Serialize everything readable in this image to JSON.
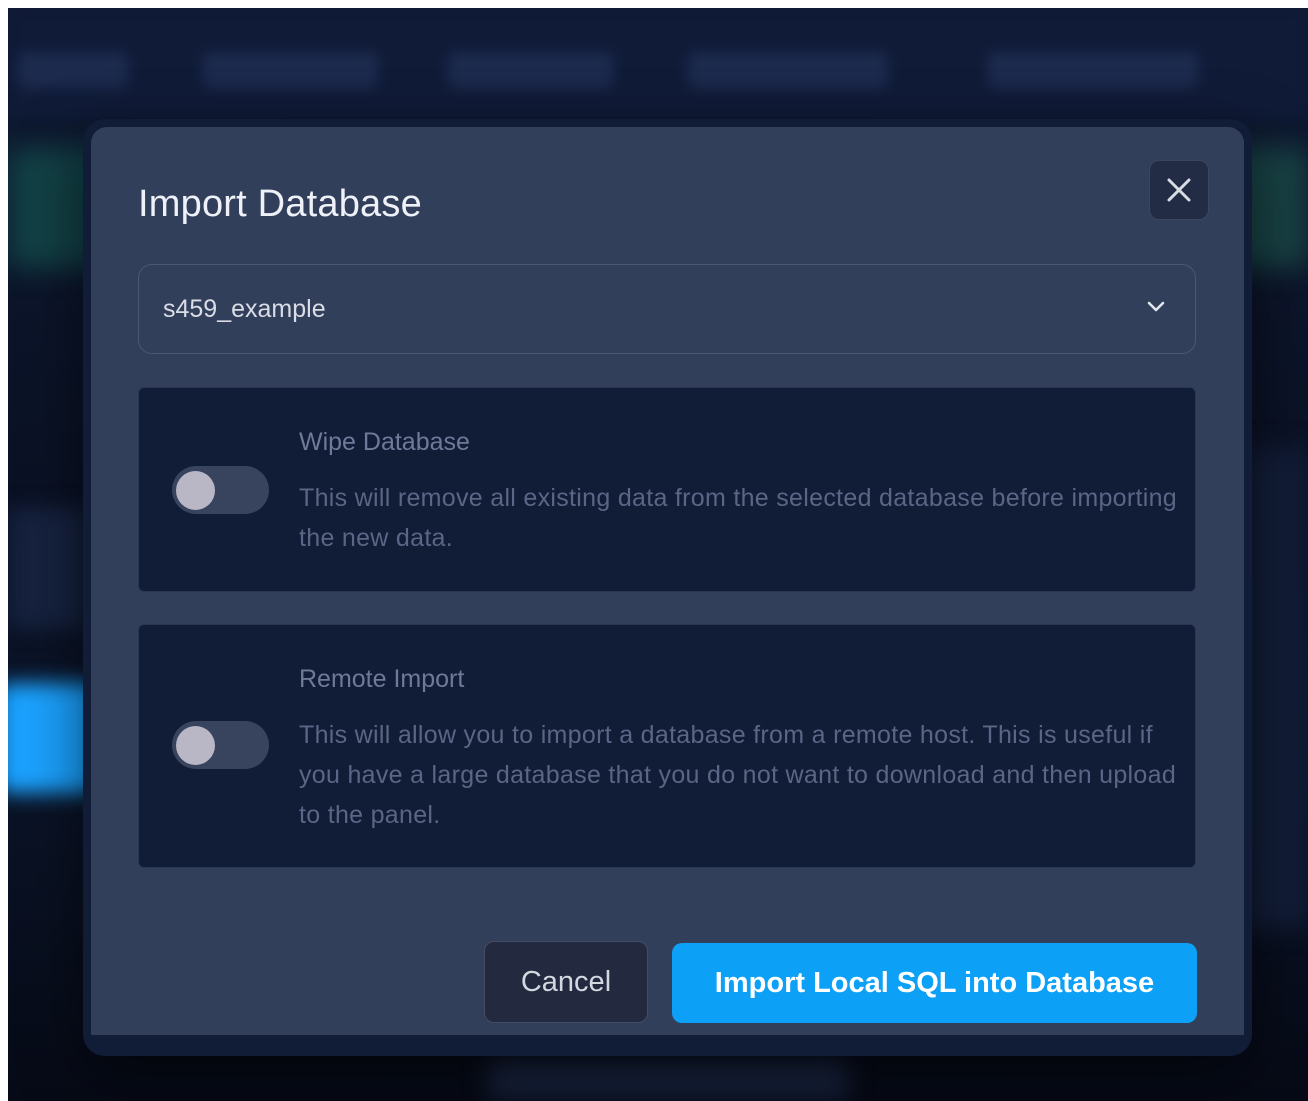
{
  "modal": {
    "title": "Import Database",
    "close_icon": "close-icon",
    "database_select": {
      "selected": "s459_example",
      "icon": "chevron-down-icon"
    },
    "options": [
      {
        "title": "Wipe Database",
        "description": "This will remove all existing data from the selected database before importing the new data.",
        "enabled": false
      },
      {
        "title": "Remote Import",
        "description": "This will allow you to import a database from a remote host. This is useful if you have a large database that you do not want to download and then upload to the panel.",
        "enabled": false
      }
    ],
    "footer": {
      "cancel_label": "Cancel",
      "import_label": "Import Local SQL into Database"
    }
  },
  "colors": {
    "accent": "#0ca0f7",
    "modal_bg": "#323f5b",
    "card_bg": "#111c37"
  }
}
